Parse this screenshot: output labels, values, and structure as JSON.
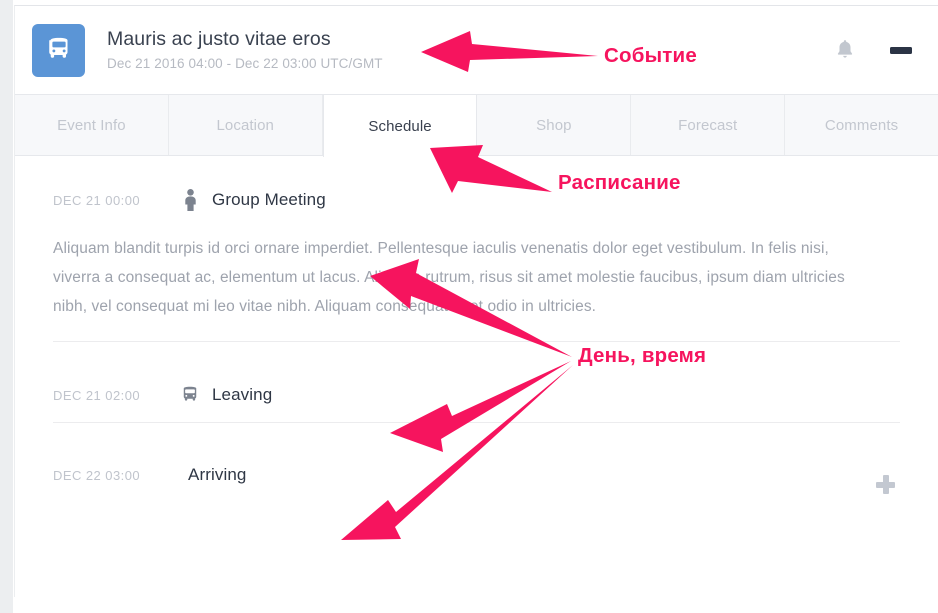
{
  "header": {
    "icon": "bus-icon",
    "title": "Mauris ac justo vitae eros",
    "subtitle": "Dec 21 2016 04:00 - Dec 22 03:00 UTC/GMT",
    "bell_icon": "bell-icon",
    "collapse_icon": "minus-icon"
  },
  "tabs": [
    {
      "label": "Event Info",
      "active": false
    },
    {
      "label": "Location",
      "active": false
    },
    {
      "label": "Schedule",
      "active": true
    },
    {
      "label": "Shop",
      "active": false
    },
    {
      "label": "Forecast",
      "active": false
    },
    {
      "label": "Comments",
      "active": false
    }
  ],
  "schedule": {
    "rows": [
      {
        "time": "DEC 21 00:00",
        "title": "Group Meeting",
        "icon": "person-icon",
        "toggle": "minus-icon",
        "body": "Aliquam blandit turpis id orci ornare imperdiet. Pellentesque iaculis venenatis dolor eget vestibulum. In felis nisi, viverra a consequat ac, elementum ut lacus. Aliquam rutrum, risus sit amet molestie faucibus, ipsum diam ultricies nibh, vel consequat mi leo vitae nibh. Aliquam consequat eget odio in ultricies."
      },
      {
        "time": "DEC 21 02:00",
        "title": "Leaving",
        "icon": "bus-icon",
        "toggle": "none",
        "body": ""
      },
      {
        "time": "DEC 22 03:00",
        "title": "Arriving",
        "icon": "none",
        "toggle": "plus-icon",
        "body": ""
      }
    ]
  },
  "annotations": [
    {
      "text": "Событие",
      "name": "annotation-event"
    },
    {
      "text": "Расписание",
      "name": "annotation-schedule"
    },
    {
      "text": "День, время",
      "name": "annotation-day-time"
    }
  ],
  "colors": {
    "accent_pink": "#f6145e",
    "icon_blue": "#5b95d6",
    "tab_active_text": "#39404e",
    "muted_text": "#c0c4cc"
  }
}
